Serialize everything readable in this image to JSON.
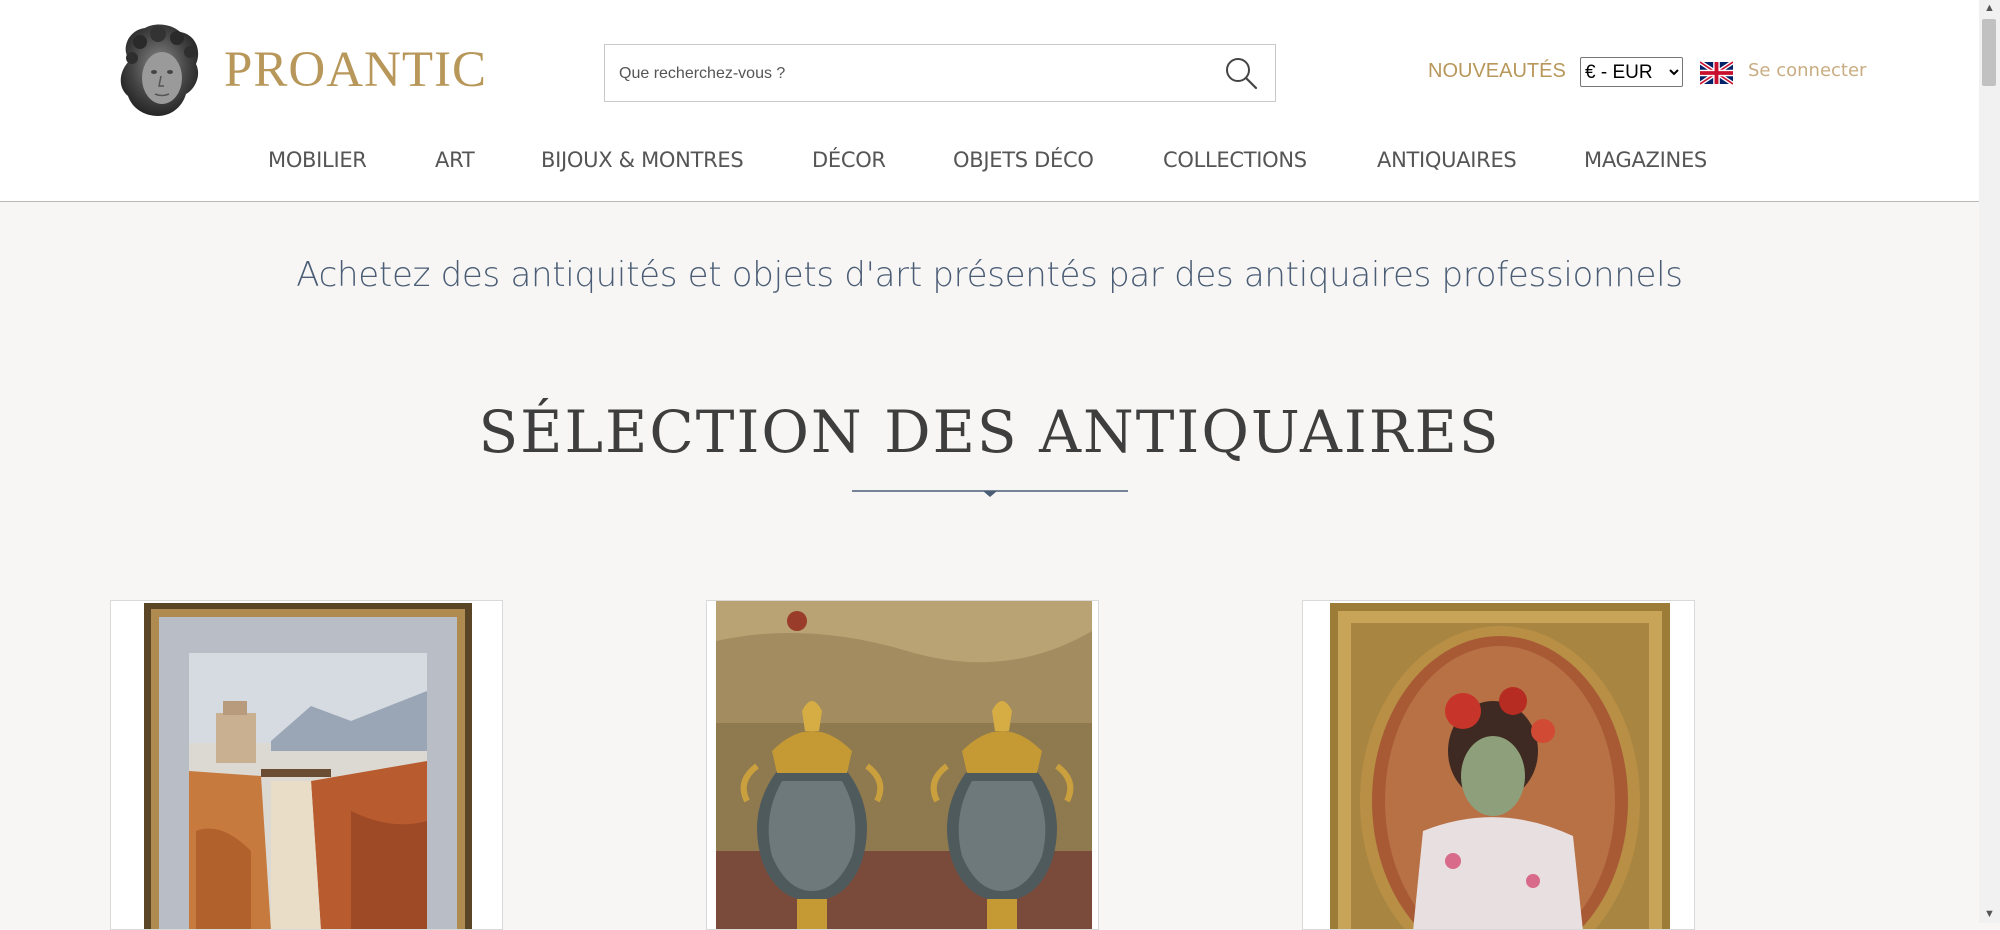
{
  "header": {
    "brand": "PROANTIC",
    "logo_icon": "marble-head-bust-logo",
    "search": {
      "placeholder": "Que recherchez-vous ?",
      "value": ""
    },
    "nouveautes_label": "NOUVEAUTÉS",
    "currency": {
      "selected": "€ - EUR",
      "options": [
        "€ - EUR"
      ]
    },
    "language_flag": "uk-flag-icon",
    "login_label": "Se connecter"
  },
  "nav": {
    "items": [
      {
        "label": "MOBILIER"
      },
      {
        "label": "ART"
      },
      {
        "label": "BIJOUX & MONTRES"
      },
      {
        "label": "DÉCOR"
      },
      {
        "label": "OBJETS DÉCO"
      },
      {
        "label": "COLLECTIONS"
      },
      {
        "label": "ANTIQUAIRES"
      },
      {
        "label": "MAGAZINES"
      }
    ]
  },
  "main": {
    "tagline": "Achetez des antiquités et objets d'art présentés par des antiquaires professionnels",
    "section_title": "SÉLECTION DES ANTIQUAIRES",
    "products": [
      {
        "image": "framed-watercolor-landscape-waterfall"
      },
      {
        "image": "pair-of-marble-ormolu-vases"
      },
      {
        "image": "framed-oval-portrait-woman-red-flowers"
      }
    ]
  },
  "colors": {
    "accent_gold": "#b8975a",
    "tagline_blue": "#4a5d75",
    "background": "#f7f6f4"
  }
}
